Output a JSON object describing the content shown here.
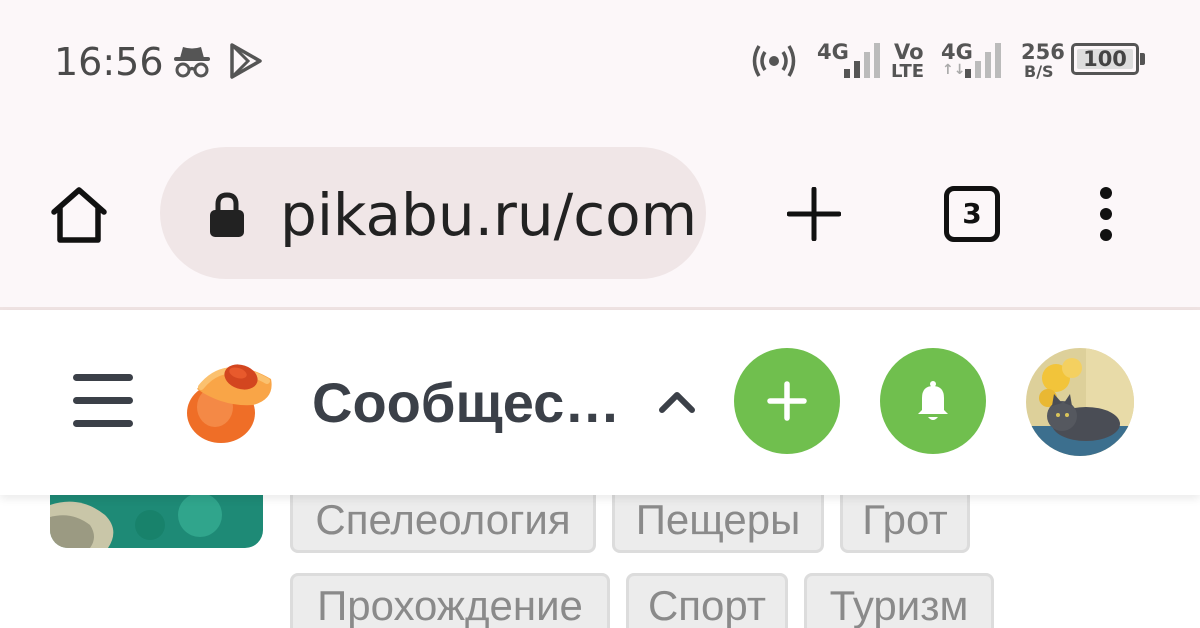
{
  "status_bar": {
    "time": "16:56",
    "net1": {
      "type": "4G"
    },
    "volte": {
      "top": "Vo",
      "bottom": "LTE"
    },
    "net2": {
      "type": "4G",
      "arrows": "↑↓"
    },
    "speed": {
      "value": "256",
      "unit": "B/S"
    },
    "battery": "100"
  },
  "browser": {
    "url": "pikabu.ru/com",
    "tab_count": "3"
  },
  "pikabu": {
    "section_title": "Сообщес…"
  },
  "tags": {
    "row1": [
      "Спелеология",
      "Пещеры",
      "Грот"
    ],
    "row2": [
      "Прохождение",
      "Спорт",
      "Туризм"
    ]
  },
  "colors": {
    "accent_green": "#70bf4e",
    "header_text": "#3b4048",
    "browser_bg": "#fcf7f9"
  }
}
